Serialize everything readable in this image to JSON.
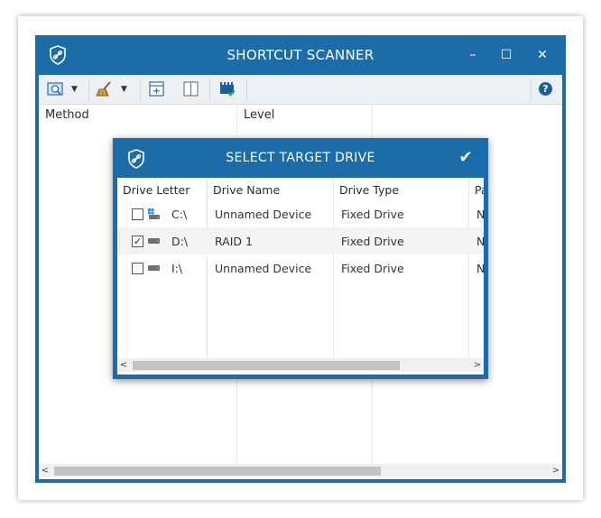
{
  "window": {
    "title": "SHORTCUT SCANNER",
    "logo_icon": "shield-link-icon",
    "controls": {
      "minimize": "–",
      "maximize": "☐",
      "close": "✕"
    }
  },
  "toolbar": {
    "buttons": [
      "scan-icon",
      "dropdown-arrow",
      "broom-clean-icon",
      "dropdown-arrow",
      "add-panel-icon",
      "split-panel-icon",
      "drive-check-icon",
      "help-icon"
    ],
    "help_label": "?"
  },
  "table": {
    "columns": [
      "Method",
      "Level"
    ]
  },
  "scroll": {
    "left_arrow": "<",
    "right_arrow": ">"
  },
  "dialog": {
    "title": "SELECT TARGET DRIVE",
    "confirm_icon": "checkmark-icon",
    "confirm_label": "✔",
    "columns": [
      "Drive Letter",
      "Drive Name",
      "Drive Type",
      "Pa"
    ],
    "rows": [
      {
        "checked": "",
        "icon": "windows-drive-icon",
        "letter": "C:\\",
        "name": "Unnamed Device",
        "type": "Fixed Drive",
        "extra": "N"
      },
      {
        "checked": "✓",
        "icon": "drive-icon",
        "letter": "D:\\",
        "name": "RAID 1",
        "type": "Fixed Drive",
        "extra": "N"
      },
      {
        "checked": "",
        "icon": "drive-icon",
        "letter": "I:\\",
        "name": "Unnamed Device",
        "type": "Fixed Drive",
        "extra": "N"
      }
    ]
  },
  "colors": {
    "accent": "#1b6ca8",
    "toolbar_bg": "#ecf1f6",
    "row_alt": "#f3f3f3"
  }
}
